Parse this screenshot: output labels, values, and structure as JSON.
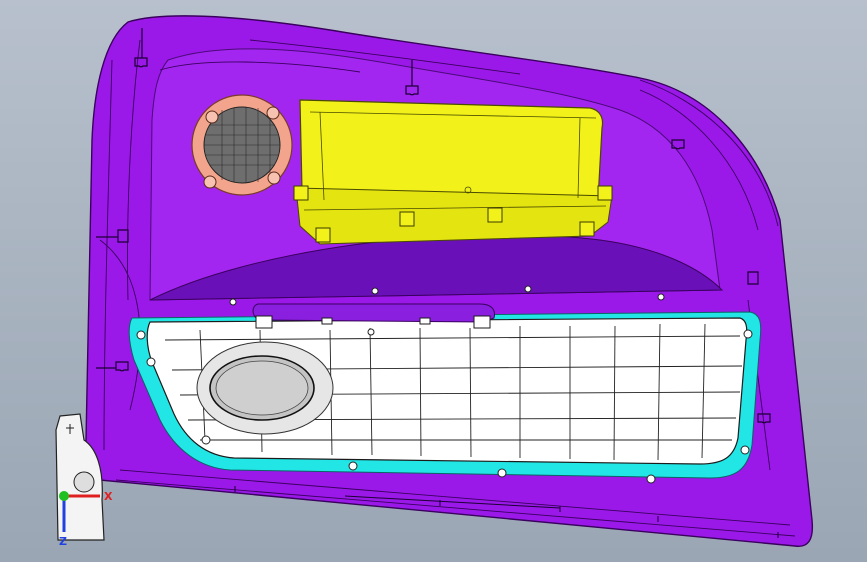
{
  "viewport": {
    "background_top": "#b7c0cc",
    "background_bottom": "#9aa6b4"
  },
  "model": {
    "panel_color": "#9a19e8",
    "pocket_color": "#ffffff",
    "seal_color": "#22e6e6",
    "module_color": "#f2f21a",
    "speaker_ring_color": "#f2a58c",
    "speaker_mesh_color": "#6e6e6e"
  },
  "triad": {
    "x_label": "X",
    "y_label": "Y",
    "z_label": "Z",
    "x_color": "#e02020",
    "y_color": "#20c020",
    "z_color": "#2040e0"
  }
}
